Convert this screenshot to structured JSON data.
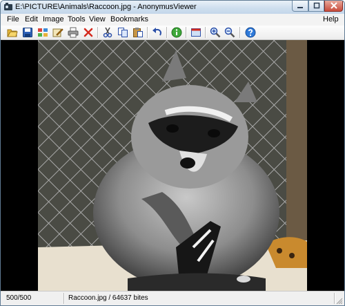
{
  "window": {
    "title": "E:\\PICTURE\\Animals\\Raccoon.jpg - AnonymusViewer"
  },
  "menu": {
    "items": [
      "File",
      "Edit",
      "Image",
      "Tools",
      "View",
      "Bookmarks"
    ],
    "help": "Help"
  },
  "toolbar": {
    "buttons": [
      "open-folder",
      "save",
      "thumbnails",
      "edit-image",
      "print",
      "delete",
      "cut",
      "copy",
      "paste",
      "undo",
      "info",
      "full-screen",
      "zoom-in",
      "zoom-out",
      "help"
    ]
  },
  "image": {
    "subject": "raccoon"
  },
  "status": {
    "index": "500/500",
    "file_info": "Raccoon.jpg / 64637 bites"
  },
  "colors": {
    "title_bar": "#cfdfee",
    "viewer_background": "#000000",
    "close_button": "#c94c3c"
  }
}
